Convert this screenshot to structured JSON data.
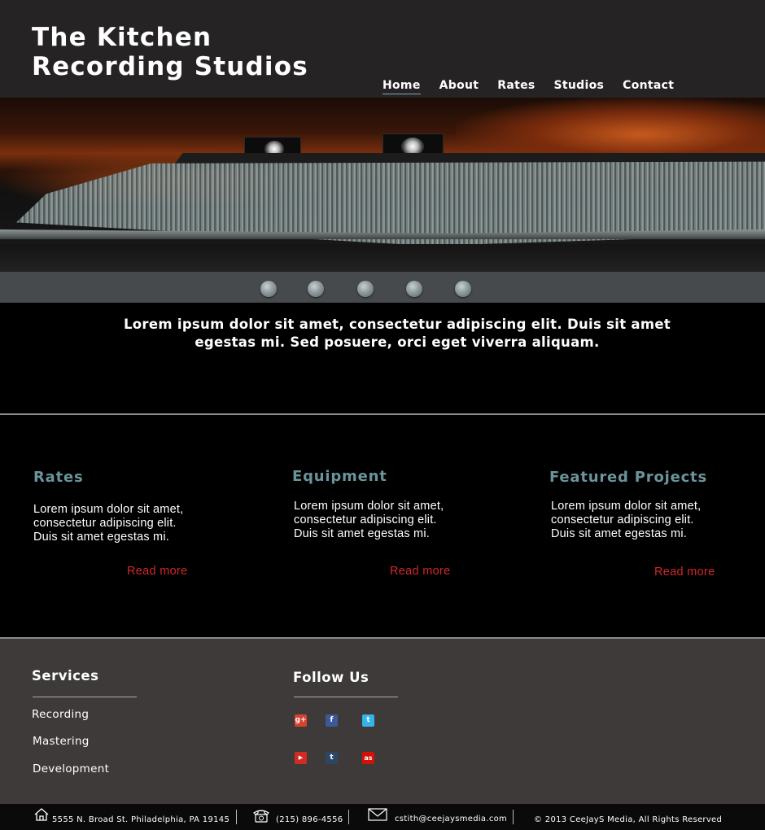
{
  "header": {
    "site_title": "The Kitchen\nRecording Studios",
    "nav": [
      {
        "label": "Home",
        "active": true
      },
      {
        "label": "About",
        "active": false
      },
      {
        "label": "Rates",
        "active": false
      },
      {
        "label": "Studios",
        "active": false
      },
      {
        "label": "Contact",
        "active": false
      }
    ]
  },
  "hero": {
    "image_name": "mixing-console-photo",
    "slides": 5,
    "current_slide": 1
  },
  "intro": {
    "text": "Lorem ipsum dolor sit amet, consectetur adipiscing elit. Duis sit amet egestas mi. Sed posuere, orci eget viverra aliquam."
  },
  "features": [
    {
      "title": "Rates",
      "body": "Lorem ipsum dolor sit amet, consectetur adipiscing elit. Duis sit amet egestas mi.",
      "link": "Read more"
    },
    {
      "title": "Equipment",
      "body": "Lorem ipsum dolor sit amet, consectetur adipiscing elit. Duis sit amet egestas mi.",
      "link": "Read more"
    },
    {
      "title": "Featured Projects",
      "body": "Lorem ipsum dolor sit amet, consectetur adipiscing elit. Duis sit amet egestas mi.",
      "link": "Read more"
    }
  ],
  "footer": {
    "services_heading": "Services",
    "services": [
      "Recording",
      "Mastering",
      "Development"
    ],
    "follow_heading": "Follow Us",
    "social": [
      {
        "icon": "google-plus-icon",
        "glyph": "g+",
        "color": "#d6432f"
      },
      {
        "icon": "facebook-icon",
        "glyph": "f",
        "color": "#3b5998"
      },
      {
        "icon": "twitter-icon",
        "glyph": "t",
        "color": "#35b4e8"
      },
      {
        "icon": "youtube-icon",
        "glyph": "▶",
        "color": "#d12b25"
      },
      {
        "icon": "tumblr-icon",
        "glyph": "t",
        "color": "#2c4762"
      },
      {
        "icon": "lastfm-icon",
        "glyph": "as",
        "color": "#d51007"
      }
    ]
  },
  "bottom_bar": {
    "address": "5555 N. Broad St. Philadelphia, PA 19145",
    "phone": "(215) 896-4556",
    "email": "cstith@ceejaysmedia.com",
    "copyright": "©  2013 CeeJayS Media, All Rights Reserved"
  },
  "colors": {
    "header_bg": "#252323",
    "accent_teal": "#6a949c",
    "link_red": "#d1272b",
    "footer_bg": "#3e3a3a"
  }
}
